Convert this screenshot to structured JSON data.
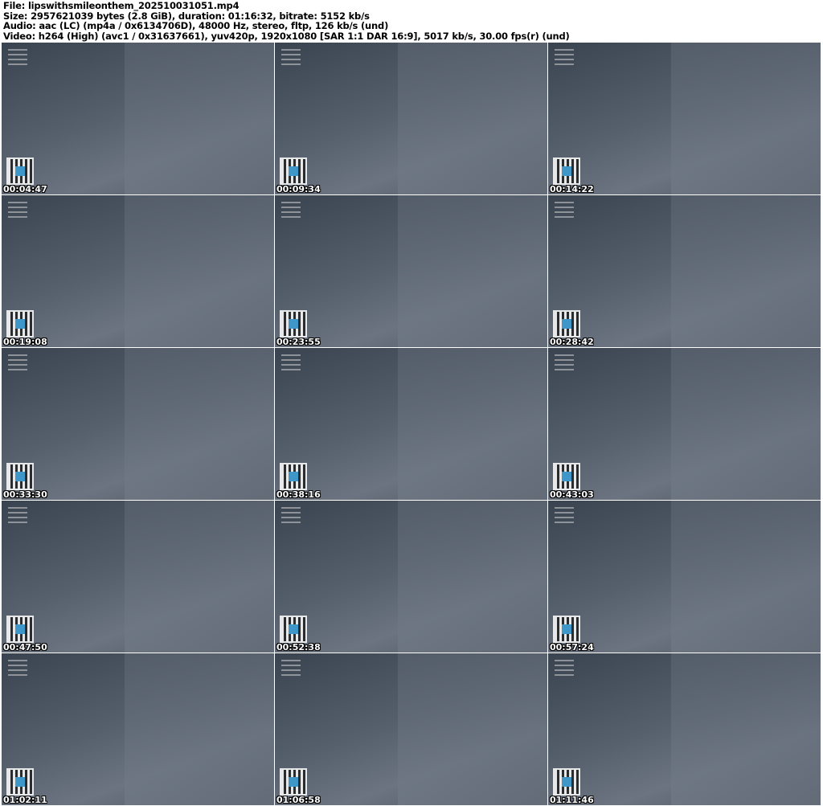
{
  "header": {
    "file": "File: lipswithsmileonthem_202510031051.mp4",
    "size": "Size: 2957621039 bytes (2.8 GiB), duration: 01:16:32, bitrate: 5152 kb/s",
    "audio": "Audio: aac (LC) (mp4a / 0x6134706D), 48000 Hz, stereo, fltp, 126 kb/s (und)",
    "video": "Video: h264 (High) (avc1 / 0x31637661), yuv420p, 1920x1080 [SAR 1:1 DAR 16:9], 5017 kb/s, 30.00 fps(r) (und)"
  },
  "thumbnails": [
    {
      "timestamp": "00:04:47"
    },
    {
      "timestamp": "00:09:34"
    },
    {
      "timestamp": "00:14:22"
    },
    {
      "timestamp": "00:19:08"
    },
    {
      "timestamp": "00:23:55"
    },
    {
      "timestamp": "00:28:42"
    },
    {
      "timestamp": "00:33:30"
    },
    {
      "timestamp": "00:38:16"
    },
    {
      "timestamp": "00:43:03"
    },
    {
      "timestamp": "00:47:50"
    },
    {
      "timestamp": "00:52:38"
    },
    {
      "timestamp": "00:57:24"
    },
    {
      "timestamp": "01:02:11"
    },
    {
      "timestamp": "01:06:58"
    },
    {
      "timestamp": "01:11:46"
    }
  ]
}
